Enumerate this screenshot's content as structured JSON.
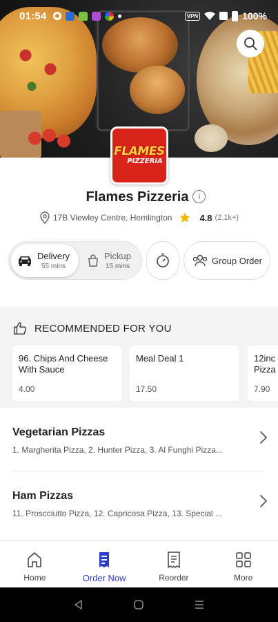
{
  "status_bar": {
    "time": "01:54",
    "battery": "100%",
    "vpn_label": "VPN"
  },
  "restaurant": {
    "logo_line1": "FLAMES",
    "logo_line2": "PIZZERIA",
    "name": "Flames Pizzeria",
    "address": "17B Viewley Centre, Hemlington",
    "rating": "4.8",
    "reviews": "(2.1k+)"
  },
  "order_mode": {
    "delivery_label": "Delivery",
    "delivery_time": "55 mins",
    "pickup_label": "Pickup",
    "pickup_time": "15 mins",
    "selected": "Delivery",
    "group_order_label": "Group Order"
  },
  "recommended": {
    "heading": "RECOMMENDED FOR YOU",
    "items": [
      {
        "name": "96. Chips And Cheese With Sauce",
        "price": "4.00"
      },
      {
        "name": "Meal Deal 1",
        "price": "17.50"
      },
      {
        "name": "12inc Pizza",
        "price": "7.90"
      }
    ]
  },
  "categories": [
    {
      "title": "Vegetarian Pizzas",
      "items": "1. Margherita Pizza, 2. Hunter Pizza, 3. Al Funghi Pizza..."
    },
    {
      "title": "Ham Pizzas",
      "items": "11. Proscciutto Pizza, 12. Capricosa Pizza, 13. Special ..."
    }
  ],
  "bottom_nav": [
    {
      "label": "Home",
      "icon": "home-icon"
    },
    {
      "label": "Order Now",
      "icon": "order-now-icon",
      "active": true
    },
    {
      "label": "Reorder",
      "icon": "receipt-icon"
    },
    {
      "label": "More",
      "icon": "grid-icon"
    }
  ],
  "colors": {
    "accent": "#2f3ec6",
    "logo_red": "#d8241a",
    "logo_yellow": "#ffd23a",
    "star": "#f5b400"
  }
}
